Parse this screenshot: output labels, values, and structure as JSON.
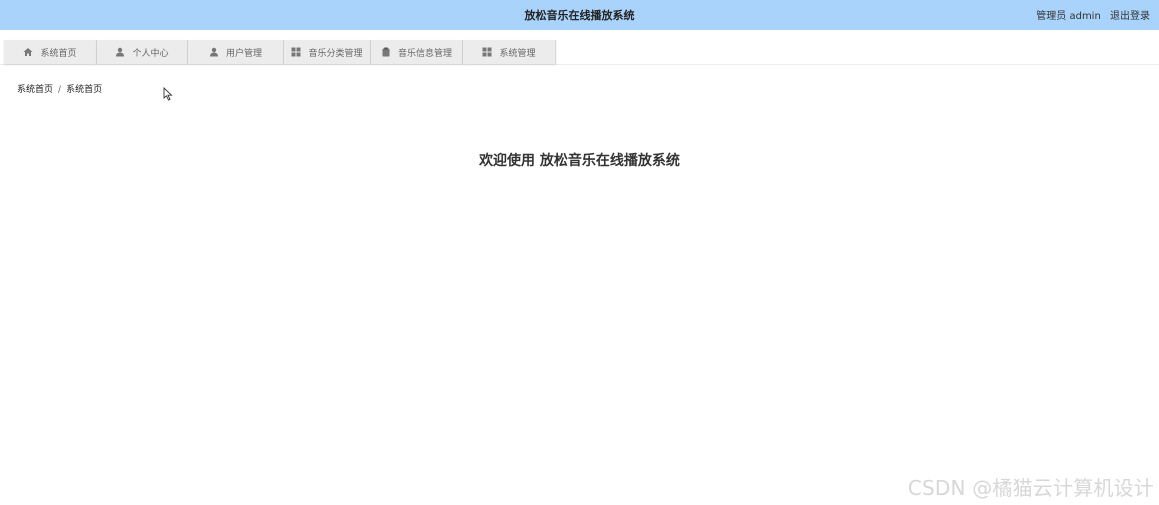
{
  "header": {
    "title": "放松音乐在线播放系统",
    "user_role": "管理员",
    "username": "admin",
    "logout_label": "退出登录",
    "background_color": "#a9d3fb"
  },
  "nav": {
    "tabs": [
      {
        "label": "系统首页",
        "icon": "home-icon"
      },
      {
        "label": "个人中心",
        "icon": "user-icon"
      },
      {
        "label": "用户管理",
        "icon": "user-icon"
      },
      {
        "label": "音乐分类管理",
        "icon": "grid-icon"
      },
      {
        "label": "音乐信息管理",
        "icon": "clipboard-icon"
      },
      {
        "label": "系统管理",
        "icon": "grid-icon"
      }
    ]
  },
  "breadcrumb": {
    "items": [
      "系统首页",
      "系统首页"
    ],
    "separator": "/"
  },
  "main": {
    "welcome_text": "欢迎使用 放松音乐在线播放系统"
  },
  "watermark": {
    "text": "CSDN @橘猫云计算机设计"
  }
}
